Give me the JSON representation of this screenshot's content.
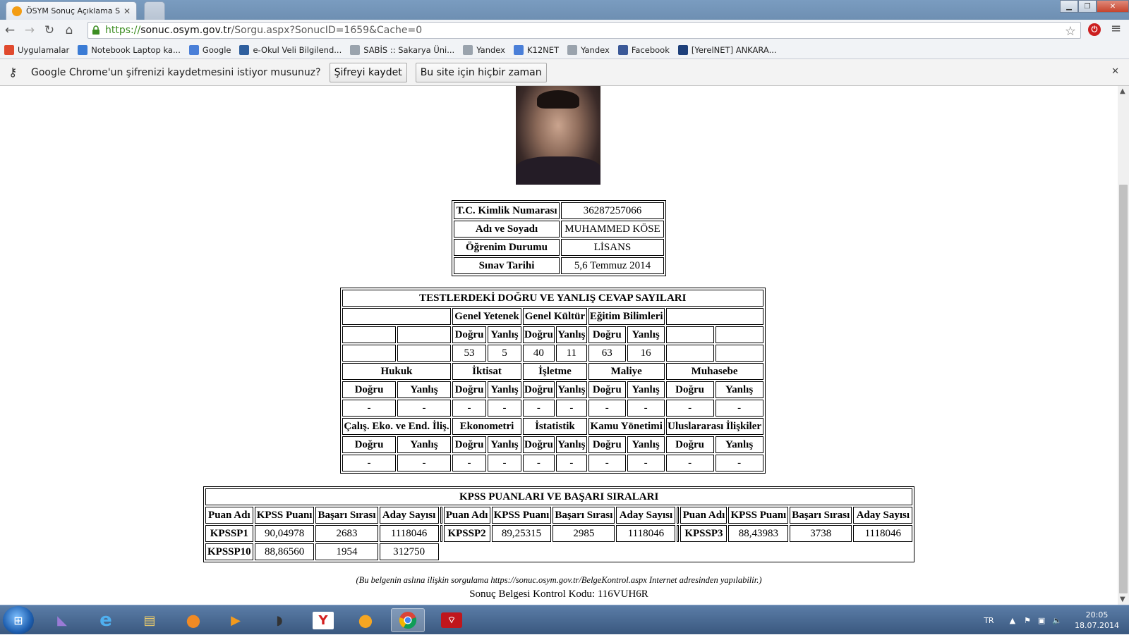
{
  "browser": {
    "tab_title": "ÖSYM Sonuç Açıklama Si",
    "url_scheme": "https://",
    "url_host": "sonuc.osym.gov.tr",
    "url_path": "/Sorgu.aspx?SonucID=1659&Cache=0",
    "bookmarks": [
      {
        "label": "Uygulamalar",
        "icon": "apps-icon",
        "color": "#e04a2f"
      },
      {
        "label": "Notebook Laptop ka...",
        "icon": "grid-icon",
        "color": "#3a7bd5"
      },
      {
        "label": "Google",
        "icon": "google-icon",
        "color": "#4a7fd8"
      },
      {
        "label": "e-Okul Veli Bilgilend...",
        "icon": "eokul-icon",
        "color": "#2f5f9e"
      },
      {
        "label": "SABİS :: Sakarya Üni...",
        "icon": "page-icon",
        "color": "#9aa3ad"
      },
      {
        "label": "Yandex",
        "icon": "page-icon",
        "color": "#9aa3ad"
      },
      {
        "label": "K12NET",
        "icon": "google-icon",
        "color": "#4a7fd8"
      },
      {
        "label": "Yandex",
        "icon": "page-icon",
        "color": "#9aa3ad"
      },
      {
        "label": "Facebook",
        "icon": "facebook-icon",
        "color": "#3b5998"
      },
      {
        "label": "[YerelNET] ANKARA...",
        "icon": "yerelnet-icon",
        "color": "#1d3f7a"
      }
    ],
    "infobar": {
      "text": "Google Chrome'un şifrenizi kaydetmesini istiyor musunuz?",
      "save_label": "Şifreyi kaydet",
      "never_label": "Bu site için hiçbir zaman"
    }
  },
  "personal": {
    "rows": [
      {
        "label": "T.C. Kimlik Numarası",
        "value": "36287257066"
      },
      {
        "label": "Adı ve Soyadı",
        "value": "MUHAMMED KÖSE"
      },
      {
        "label": "Öğrenim Durumu",
        "value": "LİSANS"
      },
      {
        "label": "Sınav Tarihi",
        "value": "5,6 Temmuz 2014"
      }
    ]
  },
  "tests": {
    "title": "TESTLERDEKİ DOĞRU VE YANLIŞ CEVAP SAYILARI",
    "correct": "Doğru",
    "wrong": "Yanlış",
    "group1": {
      "names": [
        "",
        "Genel Yetenek",
        "Genel Kültür",
        "Eğitim Bilimleri",
        ""
      ],
      "show_headers": [
        false,
        true,
        true,
        true,
        false
      ],
      "values": [
        "",
        "",
        "53",
        "5",
        "40",
        "11",
        "63",
        "16",
        "",
        ""
      ]
    },
    "group2": {
      "names": [
        "Hukuk",
        "İktisat",
        "İşletme",
        "Maliye",
        "Muhasebe"
      ],
      "values": [
        "-",
        "-",
        "-",
        "-",
        "-",
        "-",
        "-",
        "-",
        "-",
        "-"
      ]
    },
    "group3": {
      "names": [
        "Çalış. Eko. ve End. İliş.",
        "Ekonometri",
        "İstatistik",
        "Kamu Yönetimi",
        "Uluslararası İlişkiler"
      ],
      "values": [
        "-",
        "-",
        "-",
        "-",
        "-",
        "-",
        "-",
        "-",
        "-",
        "-"
      ]
    }
  },
  "kpss": {
    "title": "KPSS PUANLARI VE BAŞARI SIRALARI",
    "headers": [
      "Puan Adı",
      "KPSS Puanı",
      "Başarı Sırası",
      "Aday Sayısı"
    ],
    "rows": [
      [
        {
          "name": "KPSSP1",
          "score": "90,04978",
          "rank": "2683",
          "count": "1118046"
        },
        {
          "name": "KPSSP2",
          "score": "89,25315",
          "rank": "2985",
          "count": "1118046"
        },
        {
          "name": "KPSSP3",
          "score": "88,43983",
          "rank": "3738",
          "count": "1118046"
        }
      ],
      [
        {
          "name": "KPSSP10",
          "score": "88,86560",
          "rank": "1954",
          "count": "312750"
        }
      ]
    ]
  },
  "footer": {
    "note": "(Bu belgenin aslına ilişkin sorgulama https://sonuc.osym.gov.tr/BelgeKontrol.aspx Internet adresinden yapılabilir.)",
    "control_code": "Sonuç Belgesi Kontrol Kodu: 116VUH6R"
  },
  "taskbar": {
    "language": "TR",
    "time": "20:05",
    "date": "18.07.2014"
  }
}
